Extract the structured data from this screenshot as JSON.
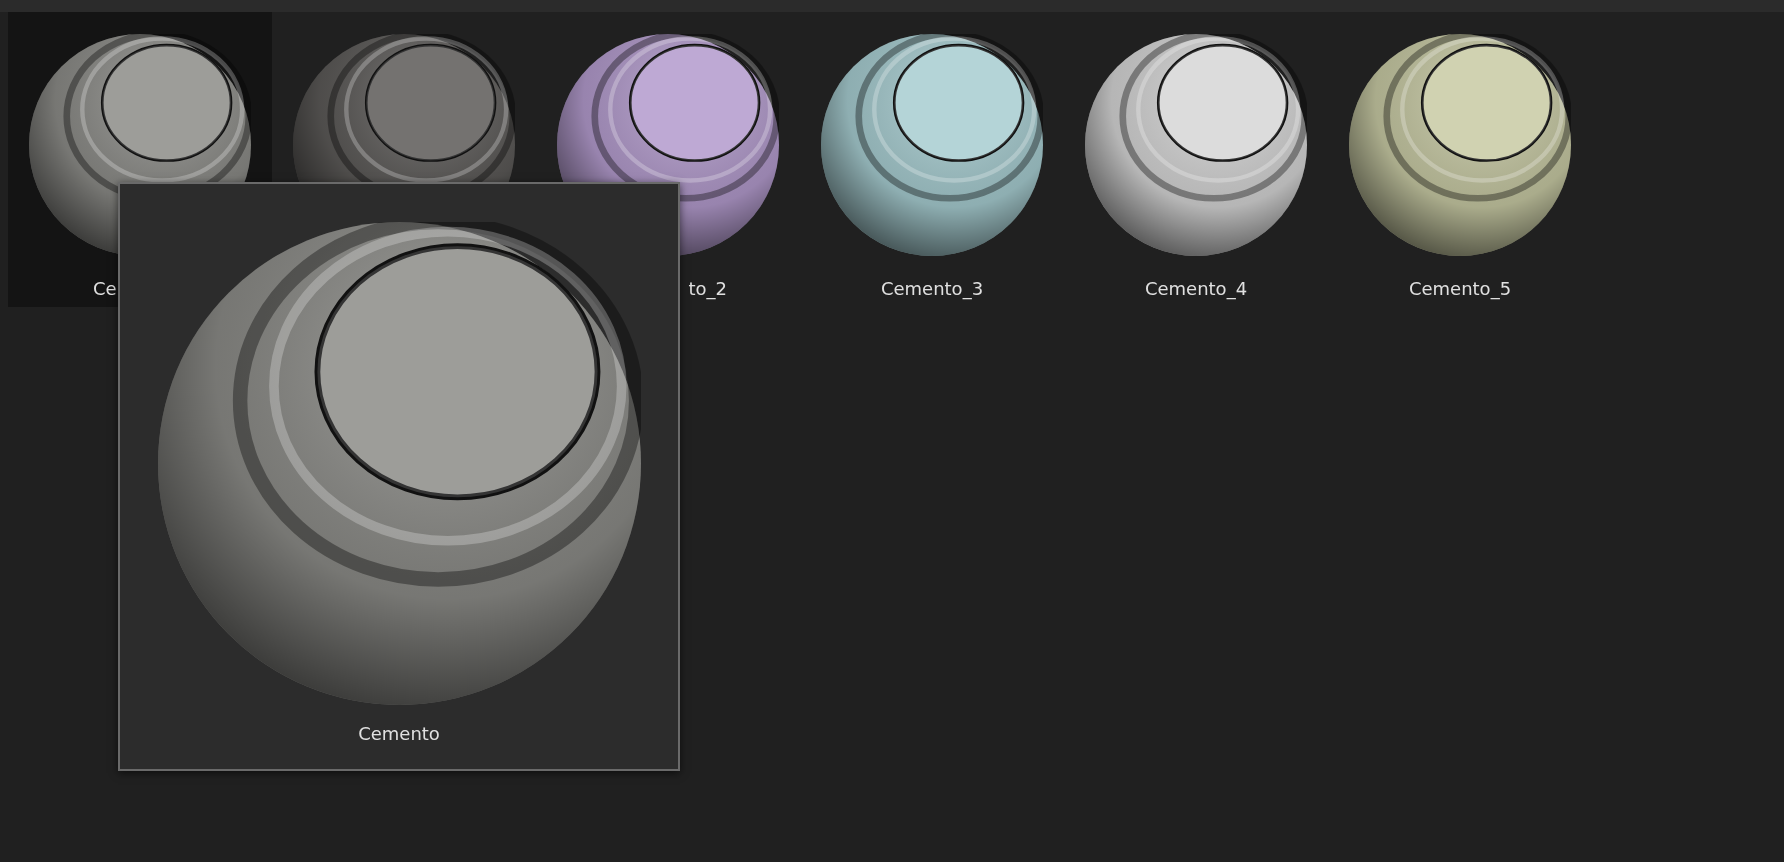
{
  "materials": [
    {
      "label": "Ce",
      "kind": "head",
      "selected": true,
      "color": "#8c8c88"
    },
    {
      "selected": false,
      "color": "#5c5a58"
    },
    {
      "label": "to_2",
      "kind": "tail",
      "selected": false,
      "color": "#b39bcd"
    },
    {
      "label": "Cemento_3",
      "selected": false,
      "color": "#a7cdd1"
    },
    {
      "label": "Cemento_4",
      "selected": false,
      "color": "#d6d6d6"
    },
    {
      "label": "Cemento_5",
      "selected": false,
      "color": "#c8caa4"
    }
  ],
  "preview": {
    "label": "Cemento",
    "color": "#8c8c88"
  }
}
